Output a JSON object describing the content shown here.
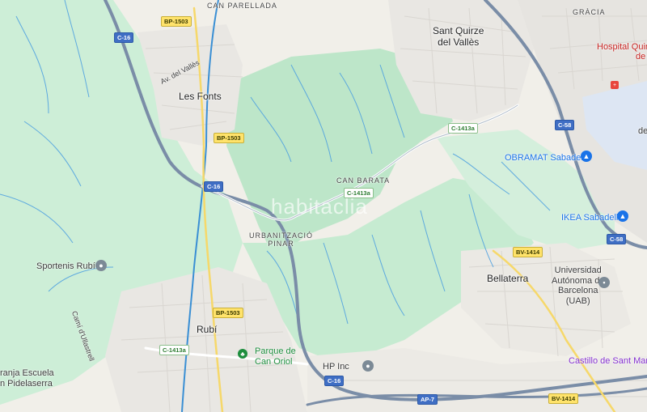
{
  "places": {
    "can_parellada": "CAN PARELLADA",
    "gracia": "GRÀCIA",
    "sant_quirze": "Sant Quirze\ndel Vallès",
    "les_fonts": "Les Fonts",
    "can_barata": "CAN BARATA",
    "urbanitzacio": "URBANITZACIÓ\nPINAR",
    "rubi": "Rubí",
    "bellaterra": "Bellaterra"
  },
  "pois": {
    "hospital": "Hospital Quiró",
    "hospital_2": "de",
    "obramat": "OBRAMAT Sabadell",
    "ikea": "IKEA Sabadell",
    "uab": "Universidad\nAutónoma de\nBarcelona\n(UAB)",
    "sportenis": "Sportenis Rubí",
    "parque": "Parque de\nCan Oriol",
    "hp": "HP Inc",
    "castillo": "Castillo de Sant Marça",
    "escuela": "ranja Escuela\nn Pidelaserra",
    "right_edge": "de",
    "street": "Av. del Vallès",
    "street2": "Camí d'Ullastrell"
  },
  "roads": {
    "bp1503_top": "BP-1503",
    "c16_left": "C-16",
    "bp1503_mid": "BP-1503",
    "c16_mid": "C-16",
    "c1413a_top": "C-1413a",
    "c1413a_mid": "C-1413a",
    "c58_top": "C-58",
    "c58_bot": "C-58",
    "bv1414_mid": "BV-1414",
    "bp1503_low": "BP-1503",
    "c1413a_low": "C-1413a",
    "c16_bot": "C-16",
    "ap7": "AP-7",
    "bv1414_bot": "BV-1414"
  },
  "watermark": "habitaclia",
  "colors": {
    "land": "#f2efe9",
    "forest": "#c8ecd3",
    "green_dark": "#b5e2c4",
    "urban": "#e8e6e3",
    "water": "#3a8fd4",
    "highway": "#8fa1b8",
    "hospital": "#c5221f",
    "shopping": "#1a73e8",
    "park": "#1e8e3e",
    "landmark": "#8430ce"
  }
}
